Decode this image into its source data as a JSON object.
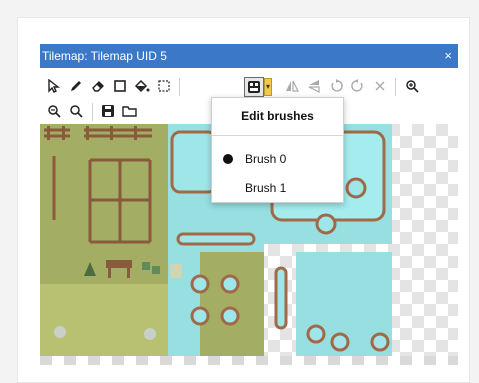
{
  "window": {
    "title": "Tilemap: Tilemap UID 5",
    "close_glyph": "×"
  },
  "toolbar": {
    "row1": [
      "select-icon",
      "pencil-icon",
      "eraser-icon",
      "rectangle-icon",
      "fill-bucket-icon",
      "selection-rect-icon",
      "brush-icon",
      "brush-dropdown-icon",
      "flip-horizontal-icon",
      "flip-vertical-icon",
      "rotate-left-icon",
      "rotate-right-icon",
      "clear-icon",
      "zoom-in-icon"
    ],
    "row2": [
      "zoom-out-icon",
      "zoom-reset-icon",
      "save-icon",
      "open-folder-icon"
    ]
  },
  "brush_menu": {
    "title": "Edit brushes",
    "items": [
      {
        "label": "Brush 0",
        "selected": true
      },
      {
        "label": "Brush 1",
        "selected": false
      }
    ]
  },
  "colors": {
    "title_bar": "#3c78c8",
    "grass": "#a3ad63",
    "water": "#97dfe1",
    "fence": "#8a5a3c"
  }
}
